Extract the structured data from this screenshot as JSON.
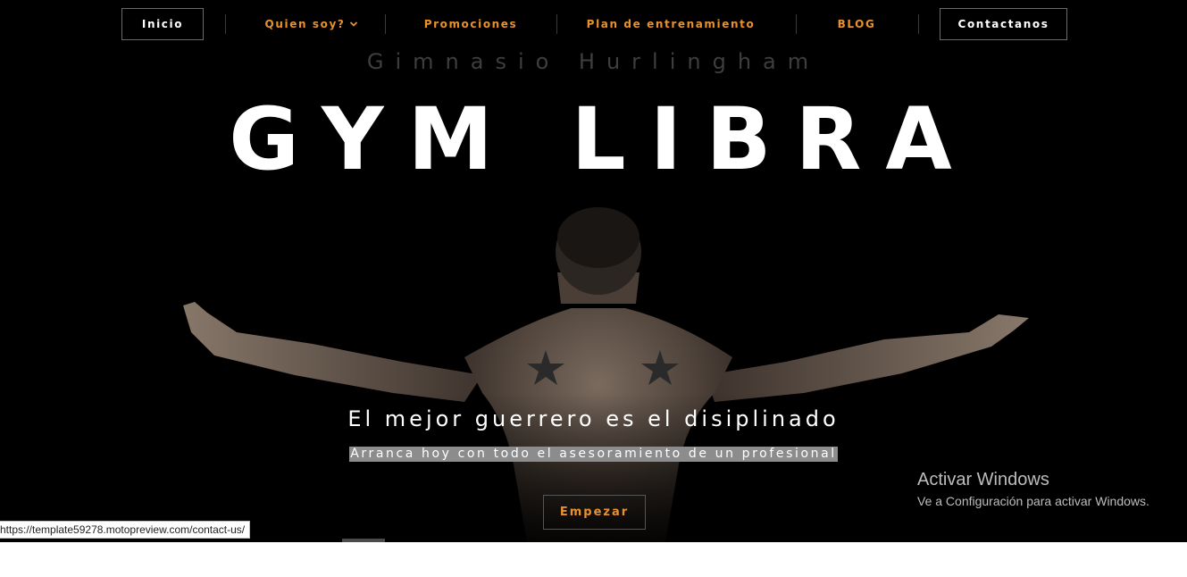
{
  "nav": {
    "inicio": "Inicio",
    "quien_soy": "Quien soy?",
    "promociones": "Promociones",
    "plan": "Plan de entrenamiento",
    "blog": "BLOG",
    "contactanos": "Contactanos"
  },
  "hero": {
    "subtitle": "Gimnasio Hurlingham",
    "headline": "GYM LIBRA",
    "tagline": "El mejor guerrero es el disiplinado",
    "subline": "Arranca hoy con todo el asesoramiento de un profesional",
    "cta": "Empezar",
    "background_image": "muscular-back-arms-spread-icon"
  },
  "windows_watermark": {
    "title": "Activar Windows",
    "subtitle": "Ve a Configuración para activar Windows."
  },
  "status_bar": {
    "url": "https://template59278.motopreview.com/contact-us/"
  },
  "colors": {
    "accent": "#e8912d",
    "background": "#000000",
    "text": "#ffffff"
  }
}
